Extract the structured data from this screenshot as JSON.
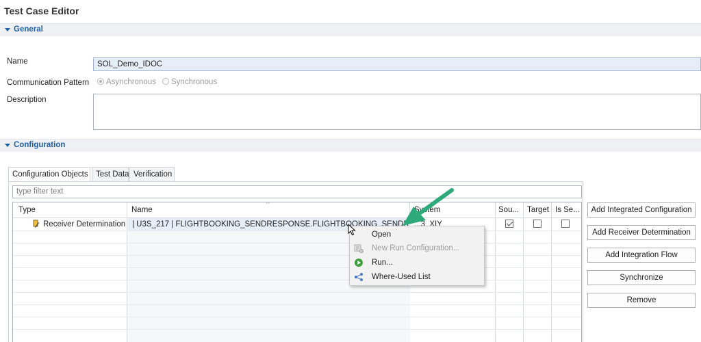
{
  "editor": {
    "title": "Test Case Editor"
  },
  "general": {
    "section_label": "General",
    "name_label": "Name",
    "name_value": "SOL_Demo_IDOC",
    "pattern_label": "Communication Pattern",
    "pattern_options": [
      "Asynchronous",
      "Synchronous"
    ],
    "pattern_selected": "Asynchronous",
    "description_label": "Description",
    "description_value": ""
  },
  "configuration": {
    "section_label": "Configuration",
    "tabs": [
      {
        "label": "Configuration Objects",
        "active": true
      },
      {
        "label": "Test Data",
        "active": false
      },
      {
        "label": "Verification",
        "active": false
      }
    ],
    "filter_placeholder": "type filter text",
    "table": {
      "columns": [
        "Type",
        "Name",
        "System",
        "Sou...",
        "Target",
        "Is Se..."
      ],
      "rows": [
        {
          "type": "Receiver Determination",
          "name": "| U3S_217 | FLIGHTBOOKING_SENDRESPONSE.FLIGHTBOOKING_SENDRESPONS",
          "system": "...3_XIY",
          "source": true,
          "target": false,
          "is_sender": false
        }
      ]
    },
    "buttons": [
      "Add Integrated Configuration",
      "Add Receiver Determination",
      "Add Integration Flow",
      "Synchronize",
      "Remove"
    ]
  },
  "context_menu": {
    "items": [
      {
        "label": "Open",
        "icon": "none",
        "enabled": true
      },
      {
        "label": "New Run Configuration...",
        "icon": "run-config-icon",
        "enabled": false
      },
      {
        "label": "Run...",
        "icon": "run-icon",
        "enabled": true
      },
      {
        "label": "Where-Used List",
        "icon": "where-used-icon",
        "enabled": true
      }
    ]
  },
  "colors": {
    "section_header": "#1f5fa8",
    "selection": "#e6eef8",
    "arrow": "#2eaa7a",
    "run_icon": "#3ca03c"
  }
}
